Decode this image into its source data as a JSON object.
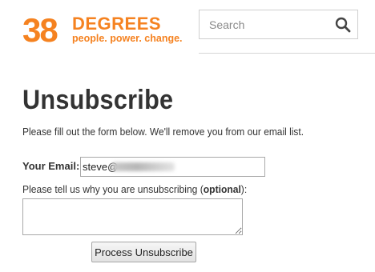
{
  "header": {
    "logo": {
      "number": "38",
      "word": "DEGREES",
      "tagline": "people. power. change.",
      "color": "#f58220"
    },
    "search": {
      "placeholder": "Search",
      "value": "",
      "icon": "search-icon"
    }
  },
  "main": {
    "title": "Unsubscribe",
    "intro": "Please fill out the form below. We'll remove you from our email list.",
    "form": {
      "email_label": "Your Email:",
      "email_value": "steve@",
      "reason_label_prefix": "Please tell us why you are unsubscribing (",
      "reason_label_bold": "optional",
      "reason_label_suffix": "):",
      "reason_value": "",
      "submit_label": "Process Unsubscribe"
    }
  }
}
